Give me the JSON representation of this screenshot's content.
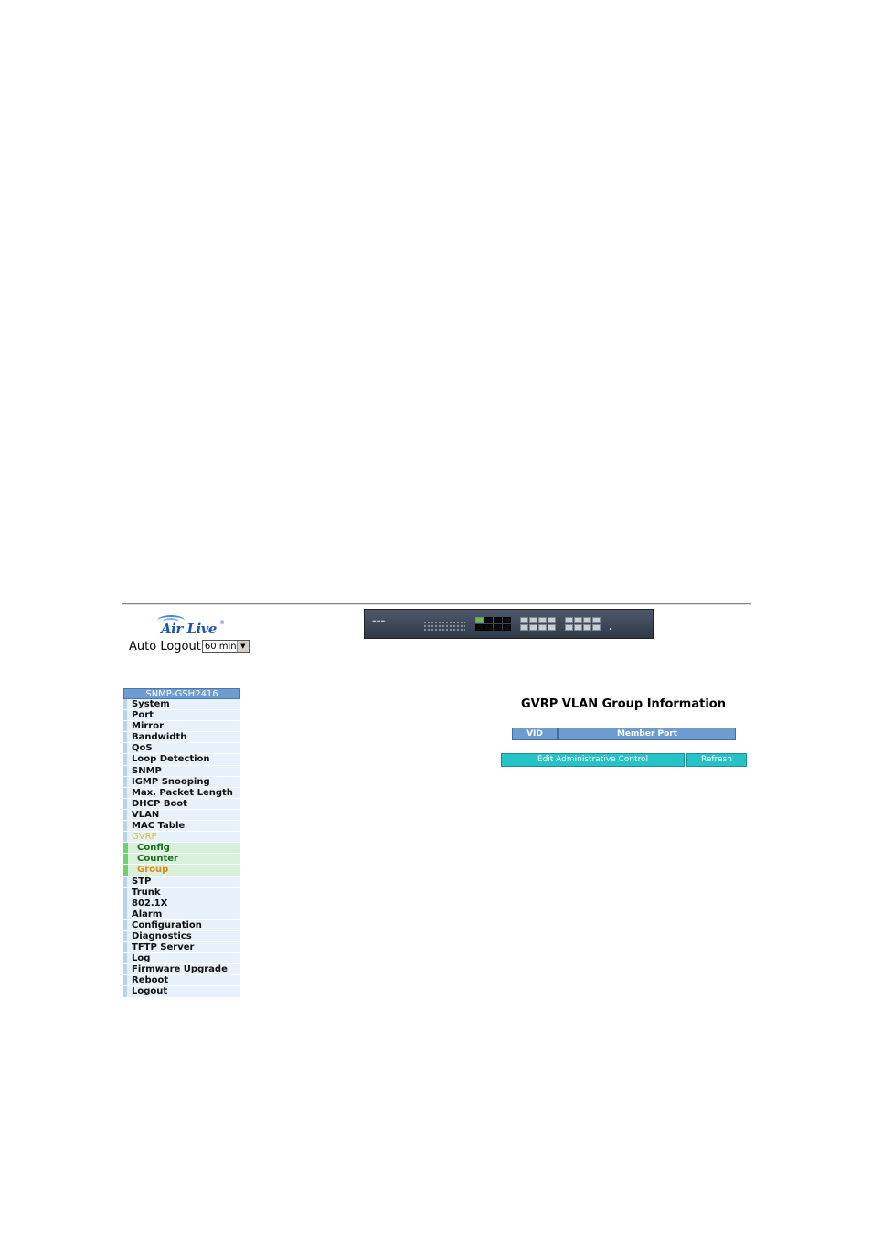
{
  "header": {
    "logo_text": "Air Live",
    "auto_logout": {
      "label": "Auto Logout",
      "selected": "60 min"
    }
  },
  "sidebar": {
    "title": "SNMP-GSH2416",
    "items_before": [
      "System",
      "Port",
      "Mirror",
      "Bandwidth",
      "QoS",
      "Loop Detection",
      "SNMP",
      "IGMP Snooping",
      "Max. Packet Length",
      "DHCP Boot",
      "VLAN",
      "MAC Table"
    ],
    "active": "GVRP",
    "sub_items": [
      "Config",
      "Counter",
      "Group"
    ],
    "current_sub": "Group",
    "items_after": [
      "STP",
      "Trunk",
      "802.1X",
      "Alarm",
      "Configuration",
      "Diagnostics",
      "TFTP Server",
      "Log",
      "Firmware Upgrade",
      "Reboot",
      "Logout"
    ]
  },
  "main": {
    "title": "GVRP VLAN Group Information",
    "columns": [
      "VID",
      "Member Port"
    ],
    "buttons": {
      "edit": "Edit Administrative Control",
      "refresh": "Refresh"
    }
  },
  "colors": {
    "menu_header": "#6f9cd0",
    "menu_item_bg": "#e6f1fb",
    "sub_item_bg": "#d9f1da",
    "active_item": "#d0c828",
    "current_sub": "#e08a1a",
    "button": "#26c3c6"
  }
}
